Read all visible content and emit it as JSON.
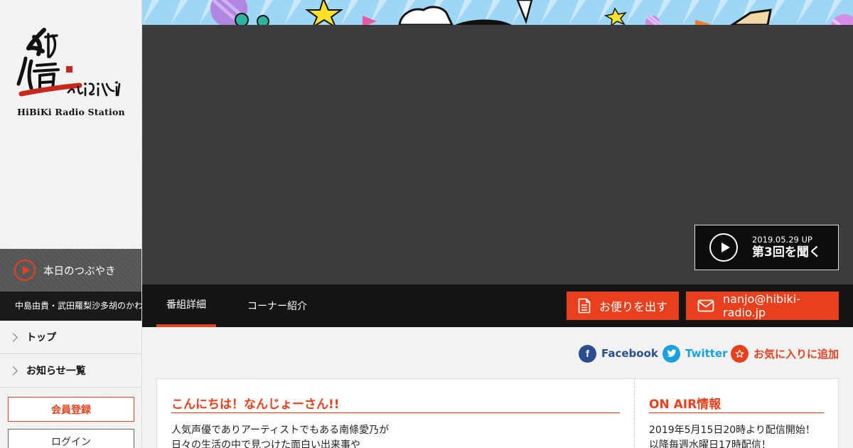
{
  "sidebar": {
    "logo": {
      "text": "響 HiBiKi",
      "caption": "HiBiKi Radio Station"
    },
    "tweet": {
      "label": "本日のつぶやき",
      "ticker": "中島由貴・武田羅梨沙多胡のかわ"
    },
    "nav": [
      {
        "label": "トップ"
      },
      {
        "label": "お知らせ一覧"
      }
    ],
    "register_label": "会員登録",
    "login_label": "ログイン"
  },
  "player": {
    "date": "2019.05.29 UP",
    "title": "第3回を聞く"
  },
  "tabs": [
    {
      "label": "番組詳細",
      "active": true
    },
    {
      "label": "コーナー紹介",
      "active": false
    }
  ],
  "actions": {
    "mail_label": "お便りを出す",
    "email": "nanjo@hibiki-radio.jp"
  },
  "social": {
    "facebook": "Facebook",
    "twitter": "Twitter",
    "favorite": "お気に入りに追加"
  },
  "main": {
    "title": "こんにちは！なんじょーさん!!",
    "lines": [
      "人気声優でありアーティストでもある南條愛乃が",
      "日々の生活の中で見つけた面白い出来事や"
    ]
  },
  "onair": {
    "title": "ON AIR情報",
    "lines": [
      "2019年5月15日20時より配信開始！",
      "以降毎週水曜日17時配信！"
    ]
  },
  "colors": {
    "accent": "#e8401c",
    "dark": "#141414",
    "video_bg": "#3c3c3c",
    "facebook": "#2b4f8e",
    "twitter": "#1aa1e0"
  }
}
